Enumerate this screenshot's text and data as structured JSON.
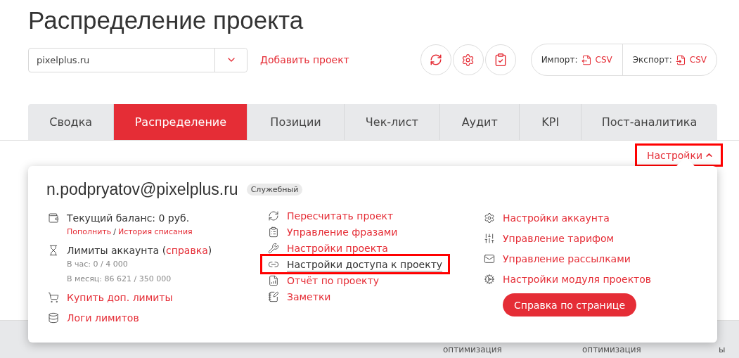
{
  "title": "Распределение проекта",
  "project_select": {
    "value": "pixelplus.ru"
  },
  "add_project": "Добавить проект",
  "transfer": [
    {
      "label": "Импорт:",
      "format": "CSV",
      "kind": "import"
    },
    {
      "label": "Экспорт:",
      "format": "CSV",
      "kind": "export"
    }
  ],
  "tabs": [
    {
      "label": "Сводка",
      "selected": false
    },
    {
      "label": "Распределение",
      "selected": true
    },
    {
      "label": "Позиции",
      "selected": false
    },
    {
      "label": "Чек-лист",
      "selected": false
    },
    {
      "label": "Аудит",
      "selected": false
    },
    {
      "label": "KPI",
      "selected": false
    },
    {
      "label": "Пост-аналитика",
      "selected": false
    }
  ],
  "settings_toggle": {
    "label": "Настройки",
    "expanded": true,
    "highlighted": true
  },
  "popup": {
    "email": "n.podpryatov@pixelplus.ru",
    "badge": "Служебный",
    "balance": {
      "text": "Текущий баланс: 0 руб.",
      "links": [
        "Пополнить",
        "История списания"
      ],
      "separator": "/"
    },
    "limits": {
      "prefix": "Лимиты аккаунта (",
      "link": "справка",
      "suffix": ")",
      "lines": [
        "В час: 0 / 4 000",
        "В месяц: 86 621 / 350 000"
      ]
    },
    "account_links": [
      "Купить доп. лимиты",
      "Логи лимитов"
    ],
    "project_links": [
      {
        "label": "Пересчитать проект",
        "highlighted": false
      },
      {
        "label": "Управление фразами",
        "highlighted": false
      },
      {
        "label": "Настройки проекта",
        "highlighted": false
      },
      {
        "label": "Настройки доступа к проекту",
        "highlighted": true
      },
      {
        "label": "Отчёт по проекту",
        "highlighted": false
      },
      {
        "label": "Заметки",
        "highlighted": false
      }
    ],
    "settings_links": [
      "Настройки аккаунта",
      "Управление тарифом",
      "Управление рассылками",
      "Настройки модуля проектов"
    ],
    "help_button": "Справка по странице"
  },
  "background_row": [
    "оптимизация",
    "оптимизация",
    "ы"
  ]
}
